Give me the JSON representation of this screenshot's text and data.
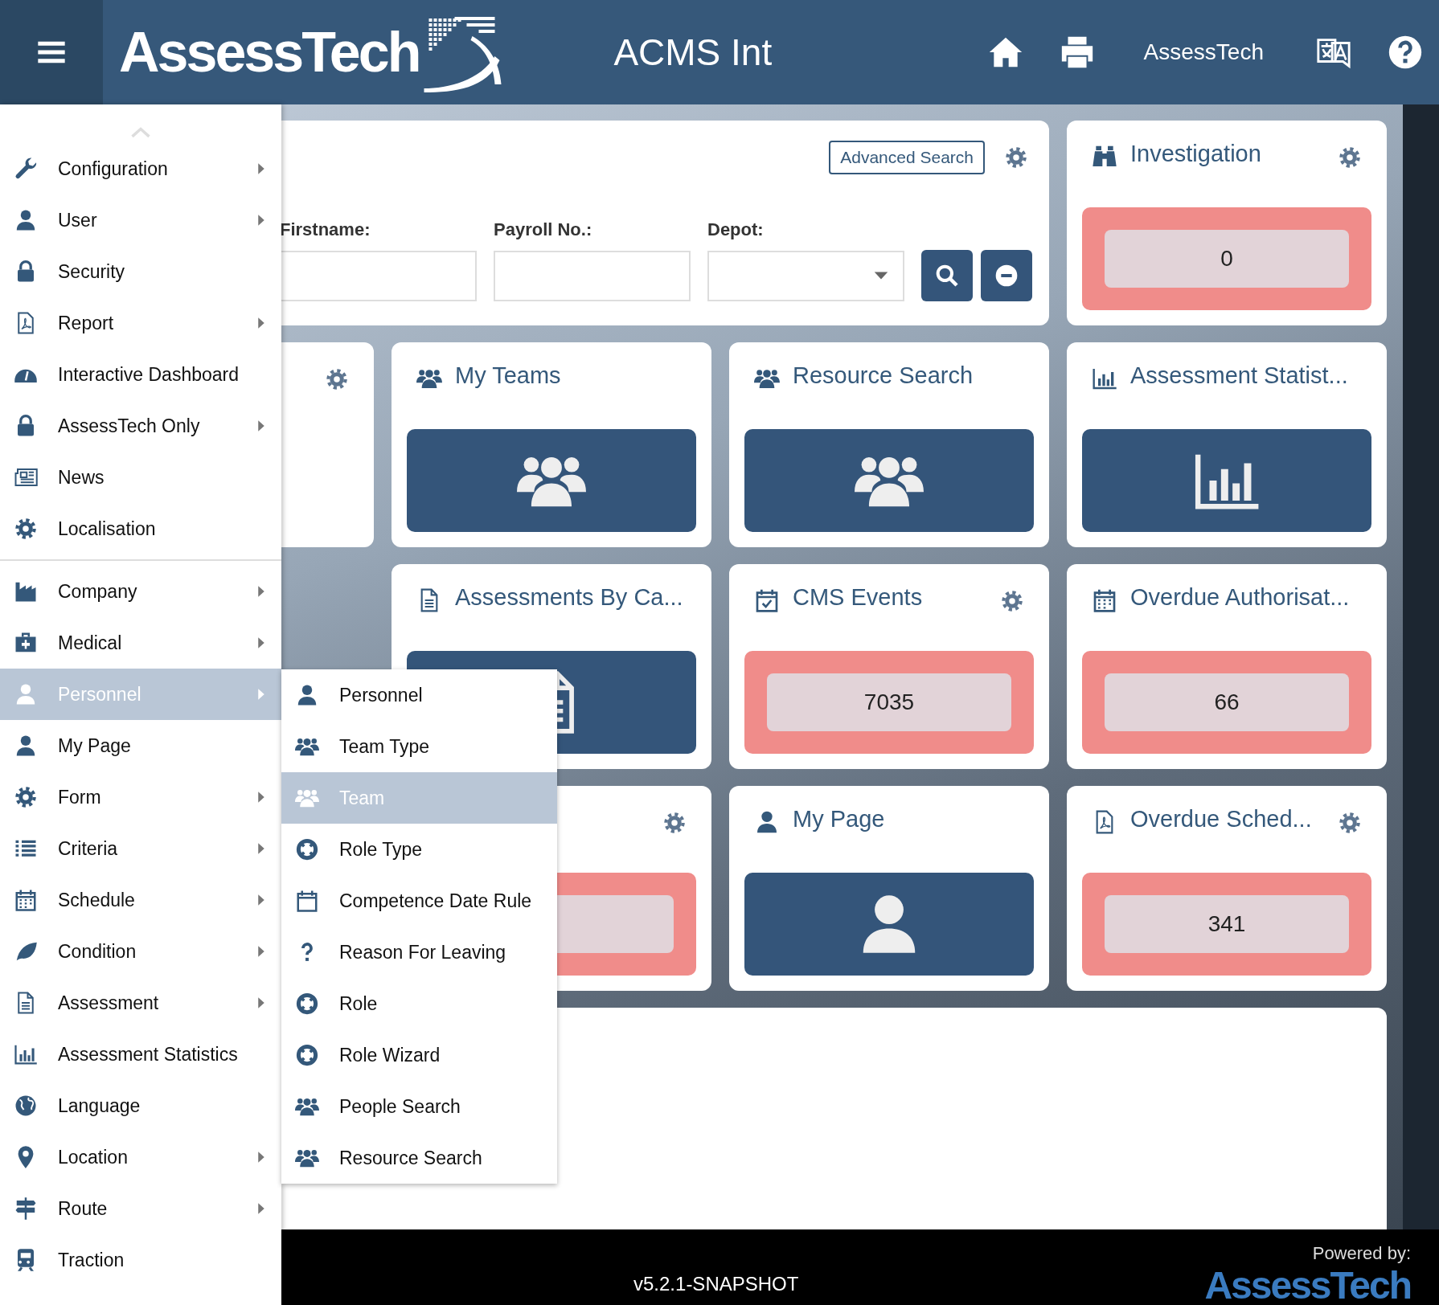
{
  "header": {
    "logo": "AssessTech",
    "title": "ACMS Int",
    "user": "AssessTech"
  },
  "sidebar": {
    "groups": [
      {
        "items": [
          {
            "label": "Configuration",
            "has_submenu": true,
            "selected": false
          },
          {
            "label": "User",
            "has_submenu": true,
            "selected": false
          },
          {
            "label": "Security",
            "has_submenu": false,
            "selected": false
          },
          {
            "label": "Report",
            "has_submenu": true,
            "selected": false
          },
          {
            "label": "Interactive Dashboard",
            "has_submenu": false,
            "selected": false
          },
          {
            "label": "AssessTech Only",
            "has_submenu": true,
            "selected": false
          },
          {
            "label": "News",
            "has_submenu": false,
            "selected": false
          },
          {
            "label": "Localisation",
            "has_submenu": false,
            "selected": false
          }
        ]
      },
      {
        "items": [
          {
            "label": "Company",
            "has_submenu": true,
            "selected": false
          },
          {
            "label": "Medical",
            "has_submenu": true,
            "selected": false
          },
          {
            "label": "Personnel",
            "has_submenu": true,
            "selected": true
          },
          {
            "label": "My Page",
            "has_submenu": false,
            "selected": false
          },
          {
            "label": "Form",
            "has_submenu": true,
            "selected": false
          },
          {
            "label": "Criteria",
            "has_submenu": true,
            "selected": false
          },
          {
            "label": "Schedule",
            "has_submenu": true,
            "selected": false
          },
          {
            "label": "Condition",
            "has_submenu": true,
            "selected": false
          },
          {
            "label": "Assessment",
            "has_submenu": true,
            "selected": false
          },
          {
            "label": "Assessment Statistics",
            "has_submenu": false,
            "selected": false
          },
          {
            "label": "Language",
            "has_submenu": false,
            "selected": false
          },
          {
            "label": "Location",
            "has_submenu": true,
            "selected": false
          },
          {
            "label": "Route",
            "has_submenu": true,
            "selected": false
          },
          {
            "label": "Traction",
            "has_submenu": false,
            "selected": false
          }
        ]
      }
    ]
  },
  "submenu": {
    "items": [
      {
        "label": "Personnel",
        "selected": false
      },
      {
        "label": "Team Type",
        "selected": false
      },
      {
        "label": "Team",
        "selected": true
      },
      {
        "label": "Role Type",
        "selected": false
      },
      {
        "label": "Competence Date Rule",
        "selected": false
      },
      {
        "label": "Reason For Leaving",
        "selected": false
      },
      {
        "label": "Role",
        "selected": false
      },
      {
        "label": "Role Wizard",
        "selected": false
      },
      {
        "label": "People Search",
        "selected": false
      },
      {
        "label": "Resource Search",
        "selected": false
      }
    ]
  },
  "dashboard": {
    "tiles": [
      {
        "kind": "search",
        "settings": true,
        "advanced_search": "Advanced Search",
        "fields": [
          {
            "label": "Firstname:",
            "kind": "text"
          },
          {
            "label": "Payroll No.:",
            "kind": "text"
          },
          {
            "label": "Depot:",
            "kind": "dropdown"
          }
        ]
      },
      {
        "kind": "count",
        "title": "Investigation",
        "value": "0",
        "settings": true
      },
      {
        "kind": "covered",
        "settings": true
      },
      {
        "kind": "link",
        "title": "My Teams",
        "settings": false
      },
      {
        "kind": "link",
        "title": "Resource Search",
        "settings": false
      },
      {
        "kind": "link",
        "title": "Assessment Statist...",
        "settings": false
      },
      {
        "kind": "gap"
      },
      {
        "kind": "link",
        "title": "Assessments By Ca...",
        "settings": false
      },
      {
        "kind": "count",
        "title": "CMS Events",
        "value": "7035",
        "settings": true
      },
      {
        "kind": "count",
        "title": "Overdue Authorisat...",
        "value": "66",
        "settings": false
      },
      {
        "kind": "gap"
      },
      {
        "kind": "count",
        "settings": true
      },
      {
        "kind": "link",
        "title": "My Page",
        "settings": false
      },
      {
        "kind": "count",
        "title": "Overdue Sched...",
        "value": "341",
        "settings": true
      },
      {
        "kind": "panel"
      }
    ]
  },
  "footer": {
    "version": "v5.2.1-SNAPSHOT",
    "powered_by": "Powered by:",
    "logo": "AssessTech"
  }
}
